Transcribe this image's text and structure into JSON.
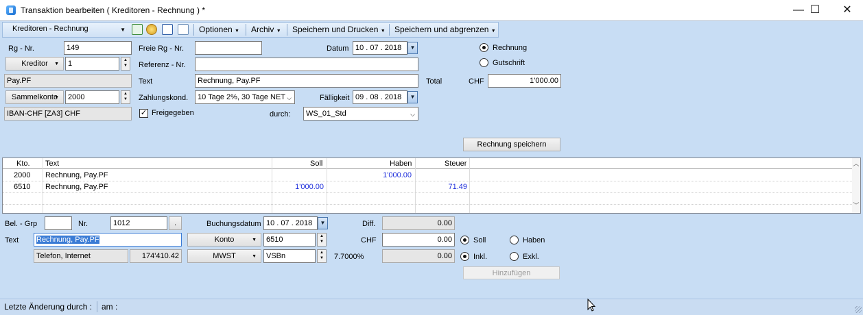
{
  "window": {
    "title": "Transaktion bearbeiten ( Kreditoren - Rechnung ) *",
    "minimize": "—",
    "maximize": "☐",
    "close": "✕"
  },
  "toolbar": {
    "type_combo": "Kreditoren - Rechnung",
    "menus": [
      "Optionen",
      "Archiv",
      "Speichern und Drucken",
      "Speichern und abgrenzen"
    ]
  },
  "header": {
    "rg_nr_label": "Rg - Nr.",
    "rg_nr": "149",
    "freie_rg_label": "Freie Rg - Nr.",
    "freie_rg": "",
    "datum_label": "Datum",
    "datum": "10 . 07 . 2018",
    "kreditor_button": "Kreditor",
    "kreditor_nr": "1",
    "referenz_label": "Referenz - Nr.",
    "referenz": "",
    "kreditor_name": "Pay.PF",
    "text_label": "Text",
    "text": "Rechnung, Pay.PF",
    "total_label": "Total",
    "currency": "CHF",
    "total": "1'000.00",
    "sammelkonto_button": "Sammelkonto",
    "sammelkonto": "2000",
    "zahlungskond_label": "Zahlungskond.",
    "zahlungskond": "10 Tage 2%, 30 Tage NET",
    "faelligkeit_label": "Fälligkeit",
    "faelligkeit": "09 . 08 . 2018",
    "iban": "IBAN-CHF [ZA3] CHF",
    "freigegeben_label": "Freigegeben",
    "durch_label": "durch:",
    "durch": "WS_01_Std",
    "radio_rechnung": "Rechnung",
    "radio_gutschrift": "Gutschrift",
    "save_button": "Rechnung speichern"
  },
  "grid": {
    "columns": [
      "Kto.",
      "Text",
      "Soll",
      "Haben",
      "Steuer"
    ],
    "rows": [
      [
        "2000",
        "Rechnung, Pay.PF",
        "",
        "1'000.00",
        ""
      ],
      [
        "6510",
        "Rechnung, Pay.PF",
        "1'000.00",
        "",
        "71.49"
      ]
    ]
  },
  "entry": {
    "bel_grp_label": "Bel. - Grp",
    "bel_grp": "",
    "nr_label": "Nr.",
    "nr": "1012",
    "dot_button": ".",
    "buchungsdatum_label": "Buchungsdatum",
    "buchungsdatum": "10 . 07 . 2018",
    "diff_label": "Diff.",
    "diff": "0.00",
    "text_label": "Text",
    "text": "Rechnung, Pay.PF",
    "konto_button": "Konto",
    "konto": "6510",
    "chf_label": "CHF",
    "chf": "0.00",
    "soll_label": "Soll",
    "haben_label": "Haben",
    "konto_name": "Telefon, Internet",
    "konto_saldo": "174'410.42",
    "mwst_button": "MWST",
    "mwst": "VSBn",
    "mwst_rate": "7.7000%",
    "tax_amount": "0.00",
    "inkl_label": "Inkl.",
    "exkl_label": "Exkl.",
    "add_button": "Hinzufügen"
  },
  "status": {
    "last_change": "Letzte Änderung durch :",
    "am": "am :"
  }
}
